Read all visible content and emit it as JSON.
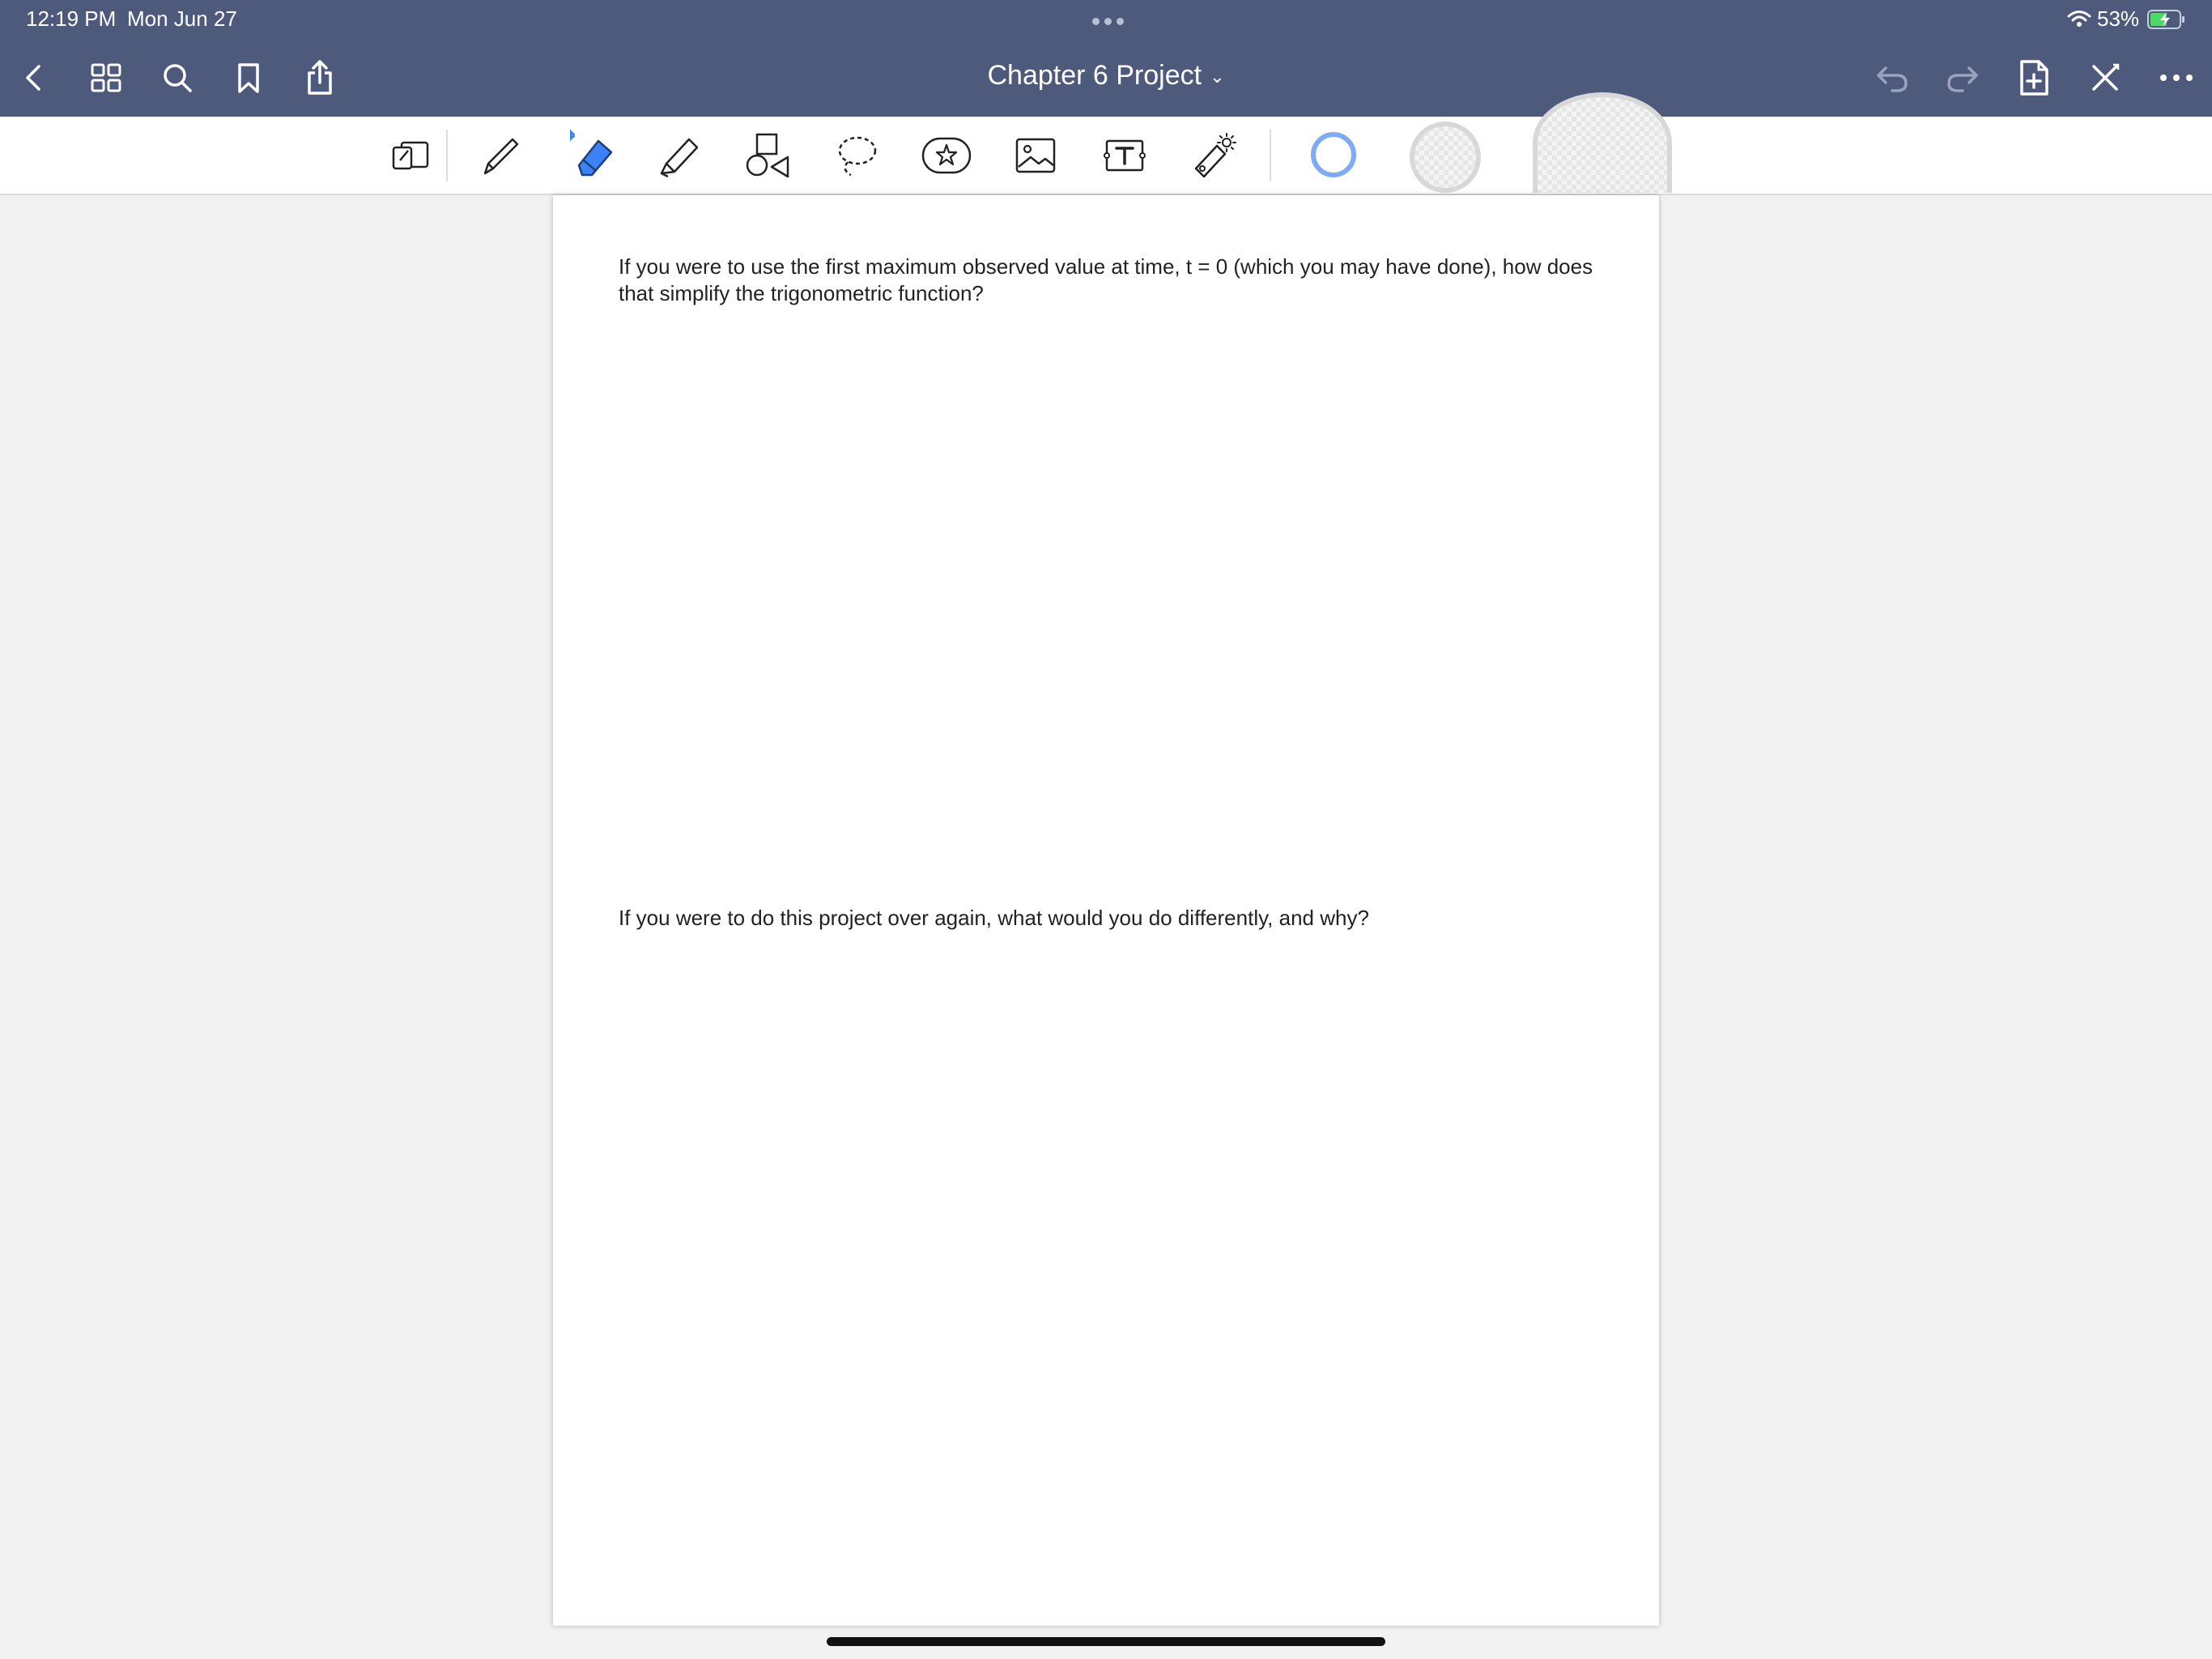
{
  "status_bar": {
    "time": "12:19 PM",
    "date": "Mon Jun 27",
    "battery_percent": "53%",
    "battery_level": 0.53,
    "charging": true
  },
  "nav_bar": {
    "title": "Chapter 6 Project",
    "left_icons": [
      "back-icon",
      "grid-icon",
      "search-icon",
      "bookmark-icon",
      "share-icon"
    ],
    "right_icons": [
      "undo-icon",
      "redo-icon",
      "add-page-icon",
      "close-icon",
      "more-icon"
    ]
  },
  "toolbar": {
    "tools": [
      "read-only-mode-icon",
      "pen-icon",
      "eraser-icon",
      "highlighter-icon",
      "shapes-icon",
      "lasso-icon",
      "sticker-icon",
      "image-icon",
      "text-box-icon",
      "laser-pointer-icon"
    ],
    "selected_tool": "eraser-icon",
    "bluetooth_indicator": true,
    "accent_color": "#3b82f6"
  },
  "document": {
    "question1": "If you were to use the first maximum observed value at time, t = 0 (which you may have done), how does that simplify the trigonometric function?",
    "question2": "If you were to do this project over again, what would you do differently, and why?"
  }
}
